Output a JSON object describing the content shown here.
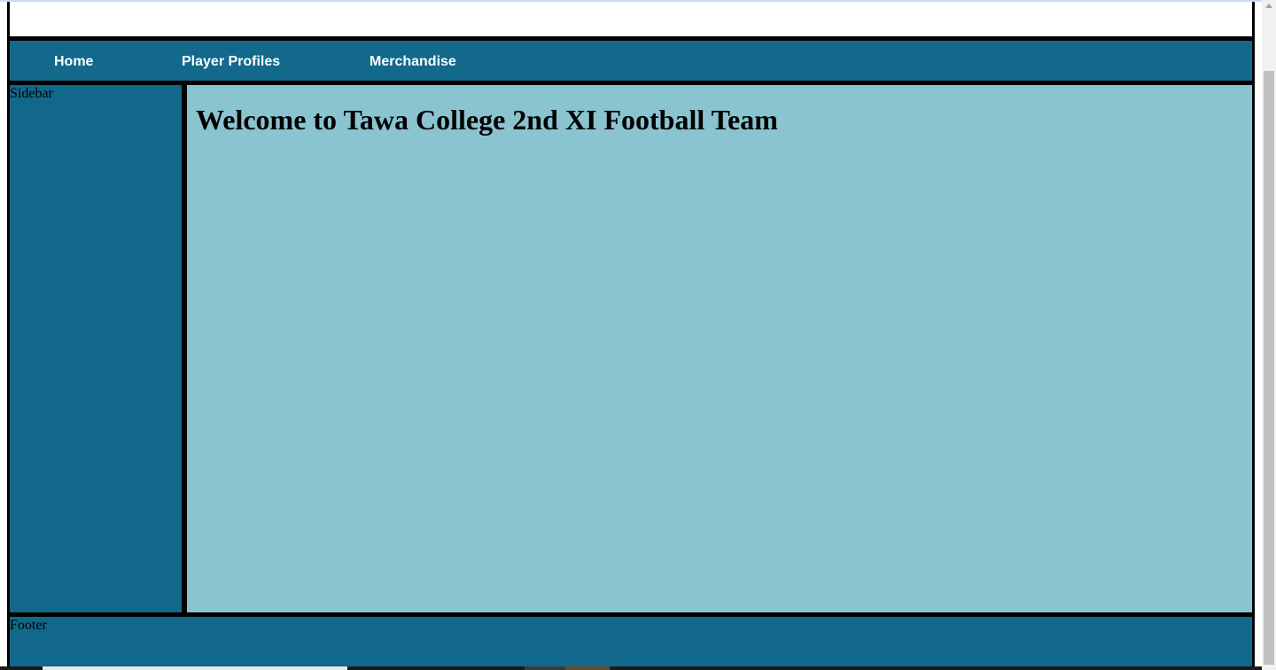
{
  "nav": {
    "items": [
      {
        "label": "Home"
      },
      {
        "label": "Player Profiles"
      },
      {
        "label": "Merchandise"
      }
    ]
  },
  "sidebar": {
    "label": "Sidebar"
  },
  "main": {
    "heading": "Welcome to Tawa College 2nd XI Football Team"
  },
  "footer": {
    "label": "Footer"
  },
  "colors": {
    "nav_background": "#12698c",
    "sidebar_background": "#12688b",
    "content_background": "#8ac4d0",
    "border": "#000000",
    "nav_text": "#ffffff"
  }
}
